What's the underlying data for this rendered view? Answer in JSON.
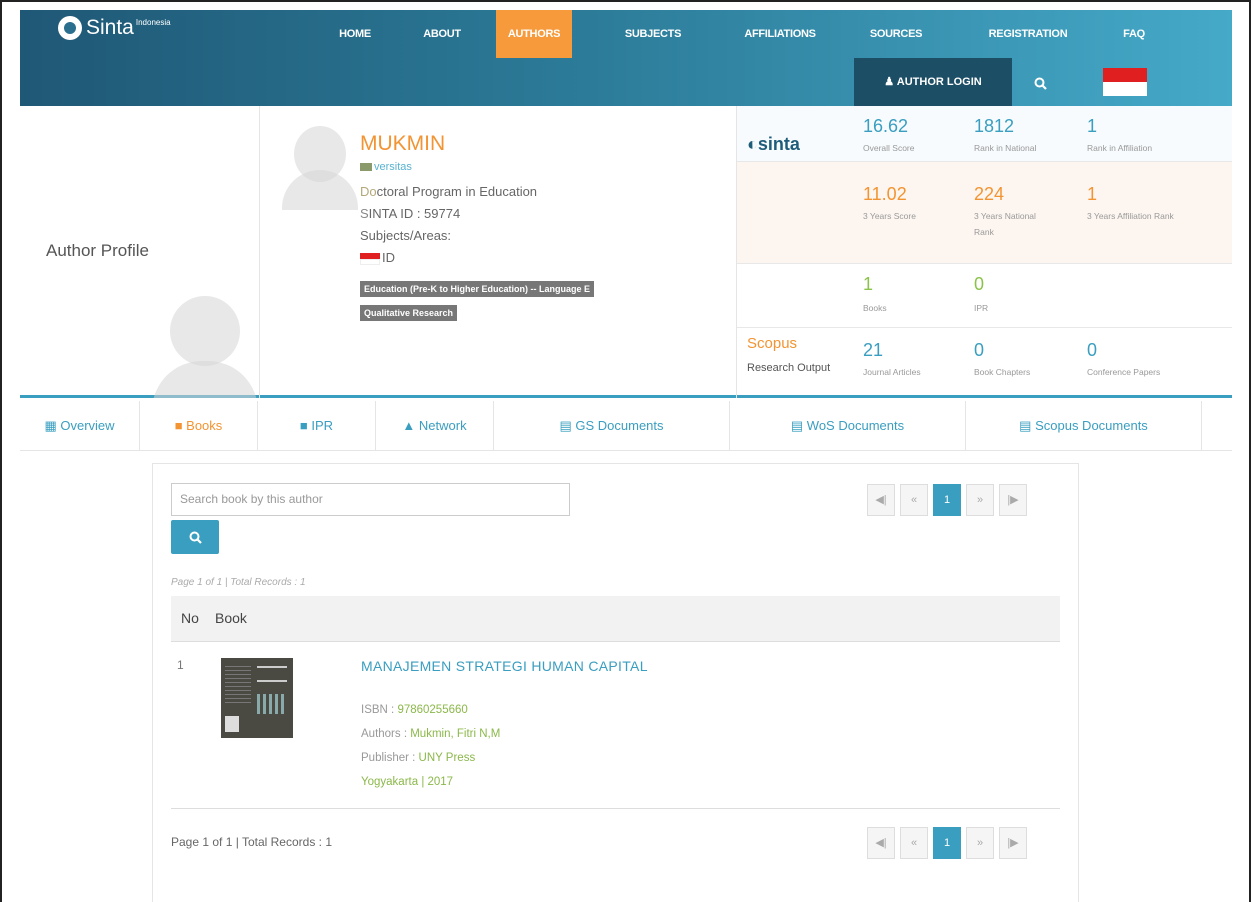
{
  "header": {
    "logo_text": "Sinta",
    "logo_super": "Indonesia",
    "nav": [
      {
        "label": "HOME"
      },
      {
        "label": "ABOUT"
      },
      {
        "label": "AUTHORS",
        "active": true
      },
      {
        "label": "SUBJECTS"
      },
      {
        "label": "AFFILIATIONS"
      },
      {
        "label": "SOURCES"
      },
      {
        "label": "REGISTRATION"
      },
      {
        "label": "FAQ"
      }
    ],
    "login_label": "AUTHOR LOGIN",
    "accent_color": "#f69a3b"
  },
  "profile": {
    "section_title": "Author Profile",
    "name": "MUKMIN",
    "university": "versitas",
    "program_prefix": "Do",
    "program": "ctoral Program in Education",
    "sinta_id_prefix": "S",
    "sinta_id": "INTA ID : 59774",
    "subjects_label": "Subjects/Areas:",
    "country": "ID",
    "tags": [
      "Education (Pre-K to Higher Education) -- Language E",
      "Qualitative Research"
    ]
  },
  "stats": {
    "sinta_logo": "sinta",
    "overall_score": "16.62",
    "overall_score_label": "Overall Score",
    "rank_national": "1812",
    "rank_national_label": "Rank in National",
    "rank_affiliation": "1",
    "rank_affiliation_label": "Rank in Affiliation",
    "three_year_score": "11.02",
    "three_year_score_label": "3 Years Score",
    "three_year_national": "224",
    "three_year_national_label": "3 Years National Rank",
    "three_year_affiliation": "1",
    "three_year_affiliation_label": "3 Years Affiliation Rank",
    "books": "1",
    "books_label": "Books",
    "ipr": "0",
    "ipr_label": "IPR",
    "scopus_label": "Scopus",
    "research_output_label": "Research Output",
    "journal_articles": "21",
    "journal_articles_label": "Journal Articles",
    "book_chapters": "0",
    "book_chapters_label": "Book Chapters",
    "conference_papers": "0",
    "conference_papers_label": "Conference Papers"
  },
  "tabs": [
    {
      "label": "Overview",
      "icon": "bar-chart-icon"
    },
    {
      "label": "Books",
      "icon": "book-icon",
      "active": true
    },
    {
      "label": "IPR",
      "icon": "book-icon"
    },
    {
      "label": "Network",
      "icon": "sitemap-icon"
    },
    {
      "label": "GS Documents",
      "icon": "document-icon"
    },
    {
      "label": "WoS Documents",
      "icon": "document-icon"
    },
    {
      "label": "Scopus Documents",
      "icon": "document-icon"
    }
  ],
  "books_panel": {
    "search_placeholder": "Search book by this author",
    "page_info_top": "Page 1 of 1 | Total Records : 1",
    "page_info_bottom": "Page 1 of 1 | Total Records : 1",
    "current_page": "1",
    "col_no": "No",
    "col_book": "Book",
    "rows": [
      {
        "no": "1",
        "title": "MANAJEMEN STRATEGI HUMAN CAPITAL",
        "isbn_label": "ISBN : ",
        "isbn": "97860255660",
        "authors_label": "Authors : ",
        "authors": "Mukmin, Fitri N,M",
        "publisher_label": "Publisher : ",
        "publisher": "UNY Press",
        "place_year": "Yogyakarta | 2017"
      }
    ]
  }
}
